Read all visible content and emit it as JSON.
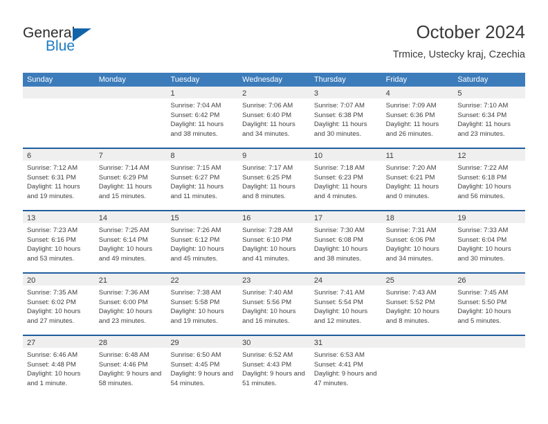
{
  "brand": {
    "name_part1": "General",
    "name_part2": "Blue"
  },
  "header": {
    "title": "October 2024",
    "subtitle": "Trmice, Ustecky kraj, Czechia"
  },
  "colors": {
    "header_blue": "#3d7cba",
    "row_divider_blue": "#1f5c9e",
    "day_band_gray": "#efefef",
    "logo_blue": "#1a7ac4"
  },
  "weekdays": [
    "Sunday",
    "Monday",
    "Tuesday",
    "Wednesday",
    "Thursday",
    "Friday",
    "Saturday"
  ],
  "weeks": [
    [
      {
        "day": "",
        "sunrise": "",
        "sunset": "",
        "daylight": ""
      },
      {
        "day": "",
        "sunrise": "",
        "sunset": "",
        "daylight": ""
      },
      {
        "day": "1",
        "sunrise": "Sunrise: 7:04 AM",
        "sunset": "Sunset: 6:42 PM",
        "daylight": "Daylight: 11 hours and 38 minutes."
      },
      {
        "day": "2",
        "sunrise": "Sunrise: 7:06 AM",
        "sunset": "Sunset: 6:40 PM",
        "daylight": "Daylight: 11 hours and 34 minutes."
      },
      {
        "day": "3",
        "sunrise": "Sunrise: 7:07 AM",
        "sunset": "Sunset: 6:38 PM",
        "daylight": "Daylight: 11 hours and 30 minutes."
      },
      {
        "day": "4",
        "sunrise": "Sunrise: 7:09 AM",
        "sunset": "Sunset: 6:36 PM",
        "daylight": "Daylight: 11 hours and 26 minutes."
      },
      {
        "day": "5",
        "sunrise": "Sunrise: 7:10 AM",
        "sunset": "Sunset: 6:34 PM",
        "daylight": "Daylight: 11 hours and 23 minutes."
      }
    ],
    [
      {
        "day": "6",
        "sunrise": "Sunrise: 7:12 AM",
        "sunset": "Sunset: 6:31 PM",
        "daylight": "Daylight: 11 hours and 19 minutes."
      },
      {
        "day": "7",
        "sunrise": "Sunrise: 7:14 AM",
        "sunset": "Sunset: 6:29 PM",
        "daylight": "Daylight: 11 hours and 15 minutes."
      },
      {
        "day": "8",
        "sunrise": "Sunrise: 7:15 AM",
        "sunset": "Sunset: 6:27 PM",
        "daylight": "Daylight: 11 hours and 11 minutes."
      },
      {
        "day": "9",
        "sunrise": "Sunrise: 7:17 AM",
        "sunset": "Sunset: 6:25 PM",
        "daylight": "Daylight: 11 hours and 8 minutes."
      },
      {
        "day": "10",
        "sunrise": "Sunrise: 7:18 AM",
        "sunset": "Sunset: 6:23 PM",
        "daylight": "Daylight: 11 hours and 4 minutes."
      },
      {
        "day": "11",
        "sunrise": "Sunrise: 7:20 AM",
        "sunset": "Sunset: 6:21 PM",
        "daylight": "Daylight: 11 hours and 0 minutes."
      },
      {
        "day": "12",
        "sunrise": "Sunrise: 7:22 AM",
        "sunset": "Sunset: 6:18 PM",
        "daylight": "Daylight: 10 hours and 56 minutes."
      }
    ],
    [
      {
        "day": "13",
        "sunrise": "Sunrise: 7:23 AM",
        "sunset": "Sunset: 6:16 PM",
        "daylight": "Daylight: 10 hours and 53 minutes."
      },
      {
        "day": "14",
        "sunrise": "Sunrise: 7:25 AM",
        "sunset": "Sunset: 6:14 PM",
        "daylight": "Daylight: 10 hours and 49 minutes."
      },
      {
        "day": "15",
        "sunrise": "Sunrise: 7:26 AM",
        "sunset": "Sunset: 6:12 PM",
        "daylight": "Daylight: 10 hours and 45 minutes."
      },
      {
        "day": "16",
        "sunrise": "Sunrise: 7:28 AM",
        "sunset": "Sunset: 6:10 PM",
        "daylight": "Daylight: 10 hours and 41 minutes."
      },
      {
        "day": "17",
        "sunrise": "Sunrise: 7:30 AM",
        "sunset": "Sunset: 6:08 PM",
        "daylight": "Daylight: 10 hours and 38 minutes."
      },
      {
        "day": "18",
        "sunrise": "Sunrise: 7:31 AM",
        "sunset": "Sunset: 6:06 PM",
        "daylight": "Daylight: 10 hours and 34 minutes."
      },
      {
        "day": "19",
        "sunrise": "Sunrise: 7:33 AM",
        "sunset": "Sunset: 6:04 PM",
        "daylight": "Daylight: 10 hours and 30 minutes."
      }
    ],
    [
      {
        "day": "20",
        "sunrise": "Sunrise: 7:35 AM",
        "sunset": "Sunset: 6:02 PM",
        "daylight": "Daylight: 10 hours and 27 minutes."
      },
      {
        "day": "21",
        "sunrise": "Sunrise: 7:36 AM",
        "sunset": "Sunset: 6:00 PM",
        "daylight": "Daylight: 10 hours and 23 minutes."
      },
      {
        "day": "22",
        "sunrise": "Sunrise: 7:38 AM",
        "sunset": "Sunset: 5:58 PM",
        "daylight": "Daylight: 10 hours and 19 minutes."
      },
      {
        "day": "23",
        "sunrise": "Sunrise: 7:40 AM",
        "sunset": "Sunset: 5:56 PM",
        "daylight": "Daylight: 10 hours and 16 minutes."
      },
      {
        "day": "24",
        "sunrise": "Sunrise: 7:41 AM",
        "sunset": "Sunset: 5:54 PM",
        "daylight": "Daylight: 10 hours and 12 minutes."
      },
      {
        "day": "25",
        "sunrise": "Sunrise: 7:43 AM",
        "sunset": "Sunset: 5:52 PM",
        "daylight": "Daylight: 10 hours and 8 minutes."
      },
      {
        "day": "26",
        "sunrise": "Sunrise: 7:45 AM",
        "sunset": "Sunset: 5:50 PM",
        "daylight": "Daylight: 10 hours and 5 minutes."
      }
    ],
    [
      {
        "day": "27",
        "sunrise": "Sunrise: 6:46 AM",
        "sunset": "Sunset: 4:48 PM",
        "daylight": "Daylight: 10 hours and 1 minute."
      },
      {
        "day": "28",
        "sunrise": "Sunrise: 6:48 AM",
        "sunset": "Sunset: 4:46 PM",
        "daylight": "Daylight: 9 hours and 58 minutes."
      },
      {
        "day": "29",
        "sunrise": "Sunrise: 6:50 AM",
        "sunset": "Sunset: 4:45 PM",
        "daylight": "Daylight: 9 hours and 54 minutes."
      },
      {
        "day": "30",
        "sunrise": "Sunrise: 6:52 AM",
        "sunset": "Sunset: 4:43 PM",
        "daylight": "Daylight: 9 hours and 51 minutes."
      },
      {
        "day": "31",
        "sunrise": "Sunrise: 6:53 AM",
        "sunset": "Sunset: 4:41 PM",
        "daylight": "Daylight: 9 hours and 47 minutes."
      },
      {
        "day": "",
        "sunrise": "",
        "sunset": "",
        "daylight": ""
      },
      {
        "day": "",
        "sunrise": "",
        "sunset": "",
        "daylight": ""
      }
    ]
  ]
}
